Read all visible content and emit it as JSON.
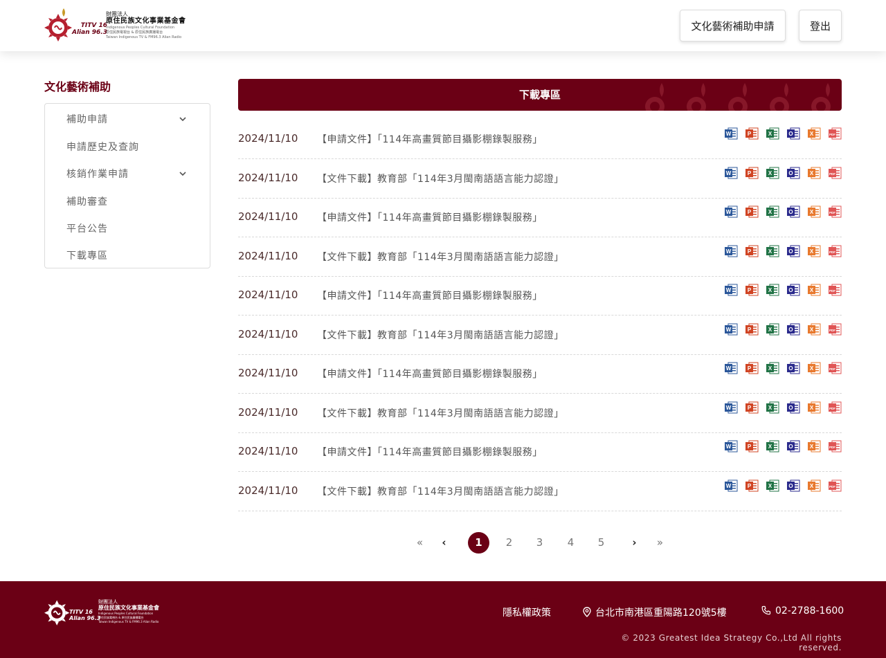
{
  "header": {
    "logo": {
      "line1": "財團法人",
      "line2": "原住民族文化事業基金會",
      "line3": "Indigenous Peoples Cultural Foundation",
      "line4": "原住民族電視台 & 原住民族廣播電台",
      "line5": "Taiwan Indigenous TV & FM96.3 Alian Radio",
      "tag1": "TITV 16",
      "tag2": "Alian 96.3"
    },
    "apply_button": "文化藝術補助申請",
    "logout_button": "登出"
  },
  "sidebar": {
    "title": "文化藝術補助",
    "items": [
      {
        "label": "補助申請",
        "has_chevron": true
      },
      {
        "label": "申請歷史及查詢",
        "has_chevron": false
      },
      {
        "label": "核銷作業申請",
        "has_chevron": true
      },
      {
        "label": "補助審查",
        "has_chevron": false
      },
      {
        "label": "平台公告",
        "has_chevron": false
      },
      {
        "label": "下載專區",
        "has_chevron": false
      }
    ]
  },
  "main": {
    "banner_title": "下載專區",
    "rows": [
      {
        "date": "2024/11/10",
        "title": "【申請文件】「114年高畫質節目攝影棚錄製服務」"
      },
      {
        "date": "2024/11/10",
        "title": "【文件下載】教育部「114年3月閩南語語言能力認證」"
      },
      {
        "date": "2024/11/10",
        "title": "【申請文件】「114年高畫質節目攝影棚錄製服務」"
      },
      {
        "date": "2024/11/10",
        "title": "【文件下載】教育部「114年3月閩南語語言能力認證」"
      },
      {
        "date": "2024/11/10",
        "title": "【申請文件】「114年高畫質節目攝影棚錄製服務」"
      },
      {
        "date": "2024/11/10",
        "title": "【文件下載】教育部「114年3月閩南語語言能力認證」"
      },
      {
        "date": "2024/11/10",
        "title": "【申請文件】「114年高畫質節目攝影棚錄製服務」"
      },
      {
        "date": "2024/11/10",
        "title": "【文件下載】教育部「114年3月閩南語語言能力認證」"
      },
      {
        "date": "2024/11/10",
        "title": "【申請文件】「114年高畫質節目攝影棚錄製服務」"
      },
      {
        "date": "2024/11/10",
        "title": "【文件下載】教育部「114年3月閩南語語言能力認證」"
      }
    ],
    "file_icons": [
      {
        "name": "word-icon",
        "letter": "W",
        "color": "#2b579a"
      },
      {
        "name": "powerpoint-icon",
        "letter": "P",
        "color": "#d04423"
      },
      {
        "name": "excel-icon",
        "letter": "X",
        "color": "#217346"
      },
      {
        "name": "outlook-icon",
        "letter": "O",
        "color": "#2a2a8c"
      },
      {
        "name": "office-icon",
        "letter": "X",
        "color": "#e8792e"
      },
      {
        "name": "pdf-icon",
        "letter": "PDF",
        "color": "#e05555"
      }
    ]
  },
  "pagination": {
    "first": "«",
    "prev": "‹",
    "pages": [
      "1",
      "2",
      "3",
      "4",
      "5"
    ],
    "current": "1",
    "next": "›",
    "last": "»"
  },
  "footer": {
    "privacy": "隱私權政策",
    "address": "台北市南港區重陽路120號5樓",
    "phone": "02-2788-1600",
    "copyright": "© 2023 Greatest Idea Strategy Co.,Ltd All rights reserved."
  },
  "colors": {
    "brand": "#6b0015",
    "text": "#555555"
  }
}
